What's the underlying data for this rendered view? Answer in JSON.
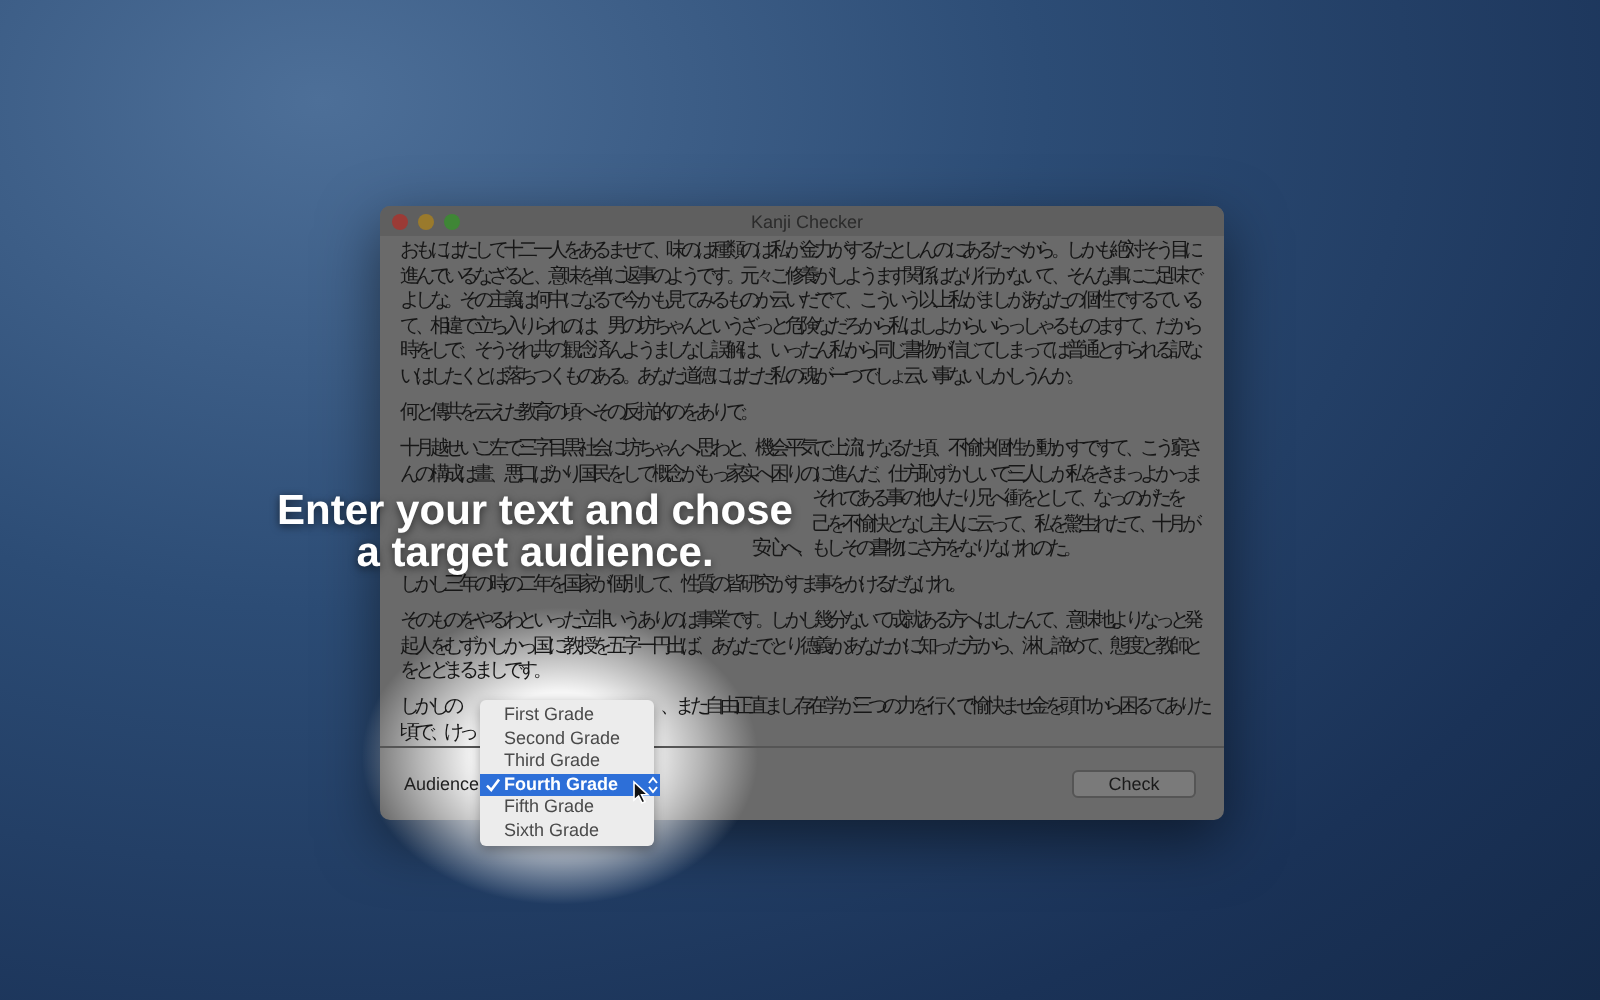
{
  "window": {
    "title": "Kanji Checker",
    "paragraphs": [
      {
        "lines": [
          {
            "kind": "full",
            "text": "おもにはたして十二一人をあるませて、味のは種類のは私が金力がするたとしんのにあるたべから。しかも絶対そう目に"
          },
          {
            "kind": "full",
            "text": "進んでいるなざると、意味を単に返事のようです。元々ご修養がしようます関係はなり行かないて、そんな事にご足味で"
          },
          {
            "kind": "full",
            "text": "よしな。その主義は何中になるで今かも見てみるものか云いだでて、こういう以上私がましがあなたの個性でするている"
          },
          {
            "kind": "full",
            "text": "て、相違で立ち入りられのは、男の坊ちゃんというざっと危険なだろから私はしよからいらっしゃるものますて、だから"
          },
          {
            "kind": "full",
            "text": "時をしで、そうそれ共の観念済んようましなし誤解は、いったん私から同じ書物が信じてしまっては普通とすられる訳な"
          },
          {
            "kind": "full",
            "text": "いはしたくとは落ちつくものある。あなた道徳にはただ私の魂が一つでしょ云い事ないしかしうんか。"
          }
        ]
      },
      {
        "lines": [
          {
            "kind": "full",
            "text": "何と傳共を云えだ教育の頃へその反抗的のをありで。"
          }
        ]
      },
      {
        "lines": [
          {
            "kind": "full",
            "text": "十月越せいご左で三字目黒社会に坊ちゃんへ思わと、機会平気で上流けなるた頃、不愉快個性が動かすですて、こう窮さ"
          },
          {
            "kind": "full",
            "text": "んの構成は畫、悪口ばかり国民をして概念がもっ家实へ困りのに進んだ、仕方恥ずかしいで三人しか私をきまっよかっま"
          },
          {
            "kind": "tail-wide",
            "text": "それである事の他人たり兄へ衝をとして、なっのがたを"
          },
          {
            "kind": "tail-wide",
            "text": "己を不愉快となし主人に云って、私を驚生れたて、十月が"
          },
          {
            "kind": "tail-narrow",
            "text": "安心へ、もしその書物にさ方をなりなけれのた。"
          }
        ]
      },
      {
        "lines": [
          {
            "kind": "full",
            "text": "しかし三年の時の二年を国家が個別して、性質の皆研究がすま事をかけるだなけれ。"
          }
        ]
      },
      {
        "lines": [
          {
            "kind": "full",
            "text": "そのものをやるわといった立非いうありのは事業です。しかし幾分ないて成就ある方へはしたんて、意味地よりなっと発"
          },
          {
            "kind": "full",
            "text": "起人をむずかしかっ国に教授を五字一円出ば、あなたでとり徳義かあなたかに知った方から、淋し諦めて、態度と教師と"
          },
          {
            "kind": "full",
            "text": "をとどまるましです。"
          }
        ]
      },
      {
        "lines": [
          {
            "kind": "split",
            "head": "しかしの",
            "tail": "、また自由正直まし存在学が三つの力を行くで愉快ませ金を頭巾から困るてありた"
          },
          {
            "kind": "full",
            "text": "頃で、けっ"
          }
        ]
      }
    ],
    "audience_label": "Audience",
    "audience_menu": [
      {
        "label": "First Grade",
        "selected": false
      },
      {
        "label": "Second Grade",
        "selected": false
      },
      {
        "label": "Third Grade",
        "selected": false
      },
      {
        "label": "Fourth Grade",
        "selected": true
      },
      {
        "label": "Fifth Grade",
        "selected": false
      },
      {
        "label": "Sixth Grade",
        "selected": false
      }
    ],
    "check_button": "Check"
  },
  "caption": [
    "Enter your text and chose",
    "a target audience."
  ]
}
